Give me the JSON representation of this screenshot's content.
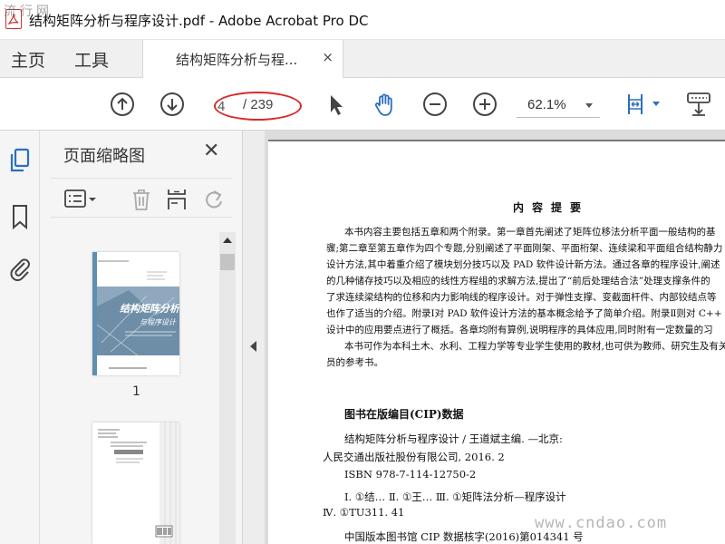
{
  "window": {
    "title": "结构矩阵分析与程序设计.pdf - Adobe Acrobat Pro DC",
    "watermark_top_left": "流行网"
  },
  "tabs": {
    "home": "主页",
    "tools": "工具",
    "document": "结构矩阵分析与程...",
    "close_glyph": "×"
  },
  "toolbar": {
    "page_current": "4",
    "page_total": "/ 239",
    "zoom": "62.1%",
    "accent_color": "#2b6fc2",
    "highlight_color": "#d92a2a"
  },
  "left_rail": {
    "icons": [
      "page-thumbnails-icon",
      "bookmark-icon",
      "attachment-icon"
    ]
  },
  "thumbnails_panel": {
    "title": "页面缩略图",
    "close_glyph": "✕",
    "page1_label": "1",
    "page1_cover_title": "结构矩阵分析",
    "page1_cover_subtitle": "与程序设计"
  },
  "document": {
    "abstract_title": "内容提要",
    "abstract_lines": [
      "本书内容主要包括五章和两个附录。第一章首先阐述了矩阵位移法分析平面一般结构的基",
      "骤;第二章至第五章作为四个专题,分别阐述了平面刚架、平面桁架、连续梁和平面组合结构静力",
      "设计方法,其中着重介绍了模块划分技巧以及 PAD 软件设计新方法。通过各章的程序设计,阐述",
      "的几种储存技巧以及相应的线性方程组的求解方法,提出了“前后处理结合法”处理支撑条件的",
      "了求连续梁结构的位移和内力影响线的程序设计。对于弹性支撑、变截面杆件、内部铰结点等",
      "也作了适当的介绍。附录Ⅰ对 PAD 软件设计方法的基本概念给予了简单介绍。附录Ⅱ则对 C++",
      "设计中的应用要点进行了概括。各章均附有算例,说明程序的具体应用,同时附有一定数量的习",
      "本书可作为本科土木、水利、工程力学等专业学生使用的教材,也可供为教师、研究生及有关",
      "员的参考书。"
    ],
    "cip_heading": "图书在版编目(CIP)数据",
    "cip_lines": [
      "结构矩阵分析与程序设计 / 王道斌主编. —北京:",
      "人民交通出版社股份有限公司, 2016. 2",
      "ISBN 978-7-114-12750-2",
      "Ⅰ. ①结…   Ⅱ. ①王…   Ⅲ. ①矩阵法分析—程序设计",
      "Ⅳ. ①TU311. 41",
      "中国版本图书馆 CIP 数据核字(2016)第014341 号"
    ],
    "watermark_bottom_right": "www.cndao.com"
  }
}
